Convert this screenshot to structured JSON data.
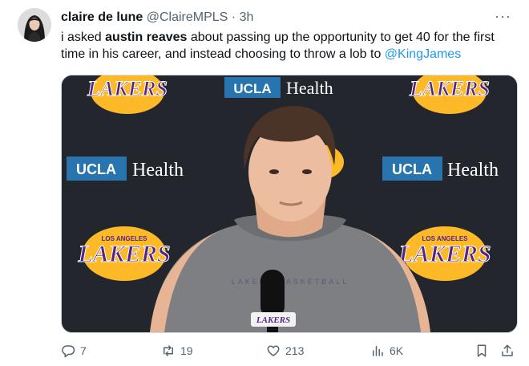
{
  "tweet": {
    "display_name": "claire de lune",
    "handle": "@ClaireMPLS",
    "separator": "·",
    "time": "3h",
    "more_label": "···",
    "text_part1": "i asked ",
    "text_bold": "austin reaves",
    "text_part2": " about passing up the opportunity to get 40 for the first time in his career, and instead choosing to throw a lob to ",
    "mention": "@KingJames"
  },
  "media": {
    "backdrop_lakers_wordmark": "LAKERS",
    "backdrop_lakers_city": "LOS ANGELES",
    "backdrop_sponsor_ucla": "UCLA",
    "backdrop_sponsor_health": "Health",
    "mic_label": "LAKERS",
    "shirt_text": "LAKERS BASKETBALL"
  },
  "actions": {
    "replies": "7",
    "retweets": "19",
    "likes": "213",
    "views": "6K"
  },
  "colors": {
    "accent": "#1d9bf0",
    "muted": "#536471",
    "lakers_gold": "#fdb927",
    "lakers_purple": "#552583",
    "ucla_blue": "#2774ae"
  }
}
